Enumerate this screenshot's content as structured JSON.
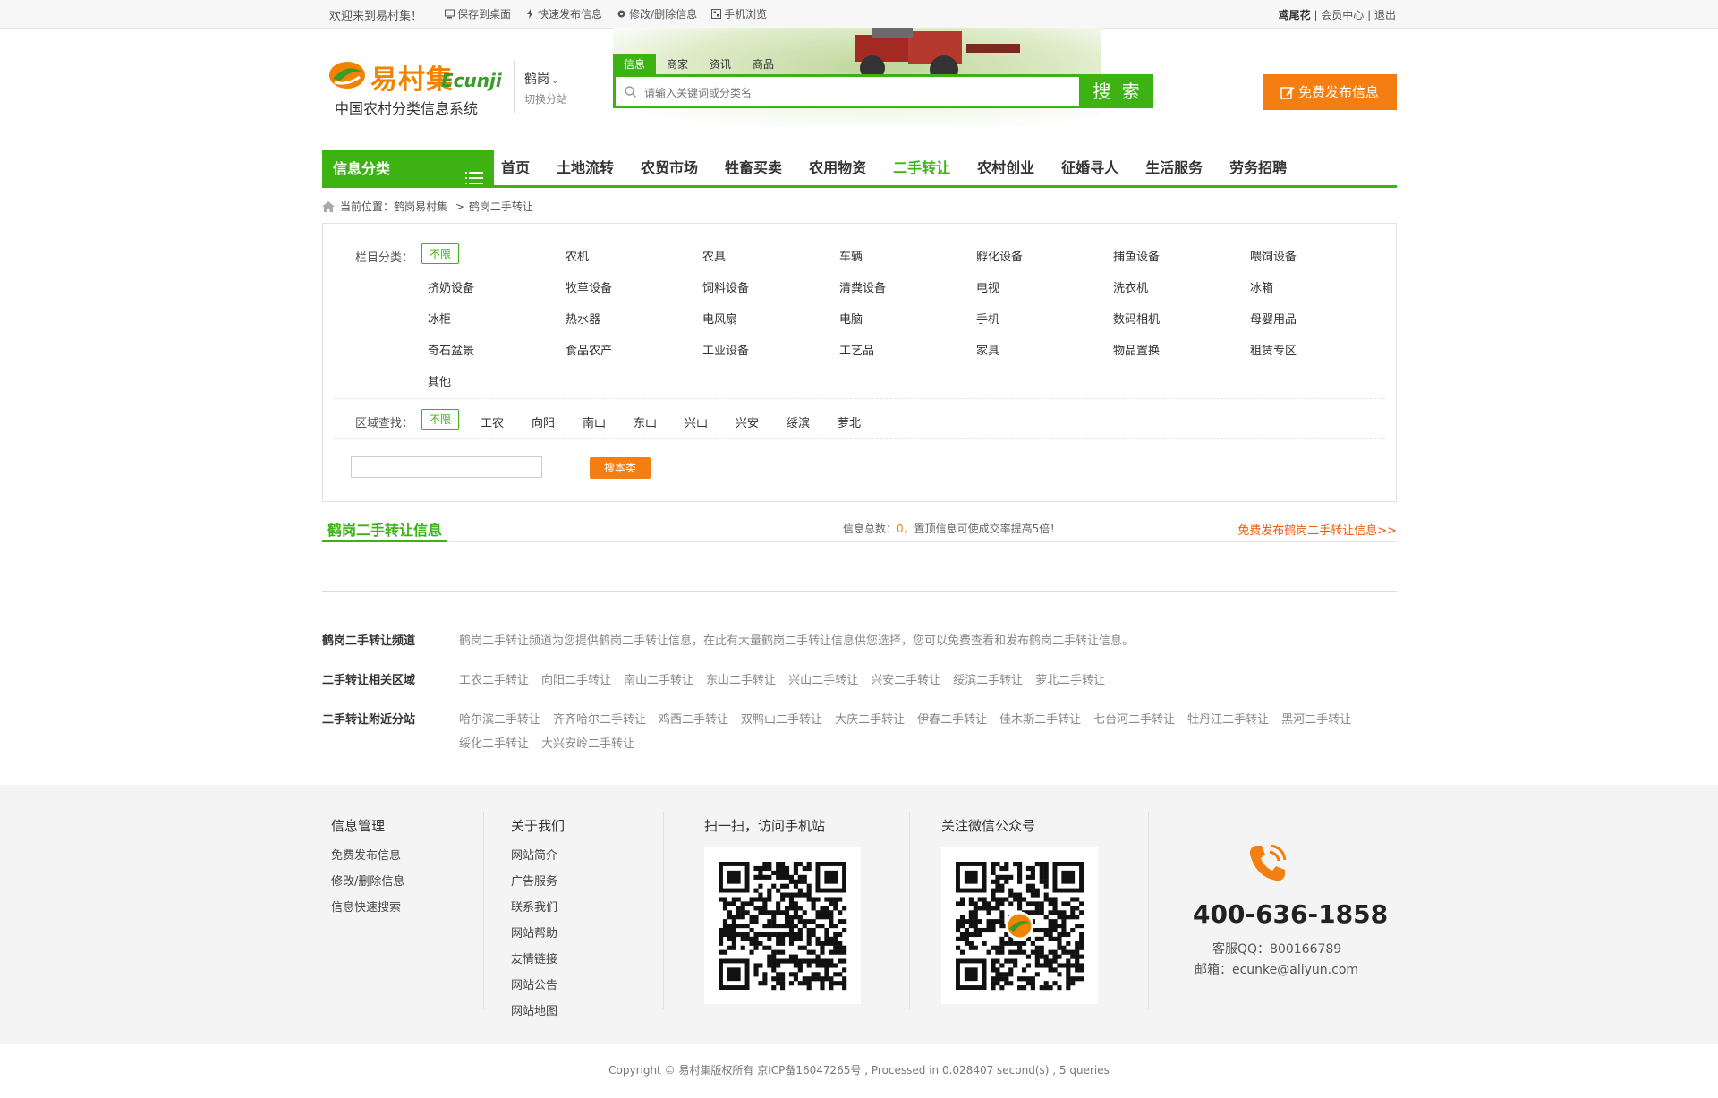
{
  "topbar": {
    "welcome": "欢迎来到易村集！",
    "links": [
      "保存到桌面",
      "快速发布信息",
      "修改/删除信息",
      "手机浏览"
    ],
    "user": "鸢尾花",
    "member_center": "会员中心",
    "logout": "退出"
  },
  "header": {
    "logo_cn": "易村集",
    "logo_en": "Ecunji",
    "slogan": "中国农村分类信息系统",
    "city": "鹤岗",
    "switch_city": "切换分站",
    "search_tabs": [
      "信息",
      "商家",
      "资讯",
      "商品"
    ],
    "search_placeholder": "请输入关键词或分类名",
    "search_button": "搜 索",
    "post_button": "免费发布信息"
  },
  "nav": {
    "category_label": "信息分类",
    "items": [
      "首页",
      "土地流转",
      "农贸市场",
      "牲畜买卖",
      "农用物资",
      "二手转让",
      "农村创业",
      "征婚寻人",
      "生活服务",
      "劳务招聘"
    ],
    "active_index": 5
  },
  "breadcrumb": {
    "prefix": "当前位置：",
    "home": "鹤岗易村集",
    "sep": ">",
    "current": "鹤岗二手转让"
  },
  "filters": {
    "category_label": "栏目分类：",
    "unlimited": "不限",
    "categories": [
      "农机",
      "农具",
      "车辆",
      "孵化设备",
      "捕鱼设备",
      "喂饲设备",
      "挤奶设备",
      "牧草设备",
      "饲料设备",
      "清粪设备",
      "电视",
      "洗衣机",
      "冰箱",
      "冰柜",
      "热水器",
      "电风扇",
      "电脑",
      "手机",
      "数码相机",
      "母婴用品",
      "奇石盆景",
      "食品农产",
      "工业设备",
      "工艺品",
      "家具",
      "物品置换",
      "租赁专区",
      "其他"
    ],
    "area_label": "区域查找：",
    "areas": [
      "工农",
      "向阳",
      "南山",
      "东山",
      "兴山",
      "兴安",
      "绥滨",
      "萝北"
    ],
    "search_button": "搜本类"
  },
  "list": {
    "title": "鹤岗二手转让信息",
    "stat_prefix": "信息总数：",
    "stat_count": "0",
    "stat_suffix": "，置顶信息可使成交率提高5倍！",
    "free_post": "免费发布鹤岗二手转让信息>>"
  },
  "seo": {
    "channel_label": "鹤岗二手转让频道",
    "channel_text": "鹤岗二手转让频道为您提供鹤岗二手转让信息，在此有大量鹤岗二手转让信息供您选择，您可以免费查看和发布鹤岗二手转让信息。",
    "region_label": "二手转让相关区域",
    "region_links": [
      "工农二手转让",
      "向阳二手转让",
      "南山二手转让",
      "东山二手转让",
      "兴山二手转让",
      "兴安二手转让",
      "绥滨二手转让",
      "萝北二手转让"
    ],
    "nearby_label": "二手转让附近分站",
    "nearby_links": [
      "哈尔滨二手转让",
      "齐齐哈尔二手转让",
      "鸡西二手转让",
      "双鸭山二手转让",
      "大庆二手转让",
      "伊春二手转让",
      "佳木斯二手转让",
      "七台河二手转让",
      "牡丹江二手转让",
      "黑河二手转让",
      "绥化二手转让",
      "大兴安岭二手转让"
    ]
  },
  "footer": {
    "col1_title": "信息管理",
    "col1_items": [
      "免费发布信息",
      "修改/删除信息",
      "信息快速搜索"
    ],
    "col2_title": "关于我们",
    "col2_items": [
      "网站简介",
      "广告服务",
      "联系我们",
      "网站帮助",
      "友情链接",
      "网站公告",
      "网站地图"
    ],
    "col3_title": "扫一扫，访问手机站",
    "col4_title": "关注微信公众号",
    "phone": "400-636-1858",
    "qq": "客服QQ：800166789",
    "mail": "邮箱：ecunke@aliyun.com",
    "copyright": "Copyright © 易村集版权所有 京ICP备16047265号 , Processed in 0.028407 second(s) , 5 queries"
  },
  "colors": {
    "green": "#3cb312",
    "orange": "#f47e12"
  }
}
